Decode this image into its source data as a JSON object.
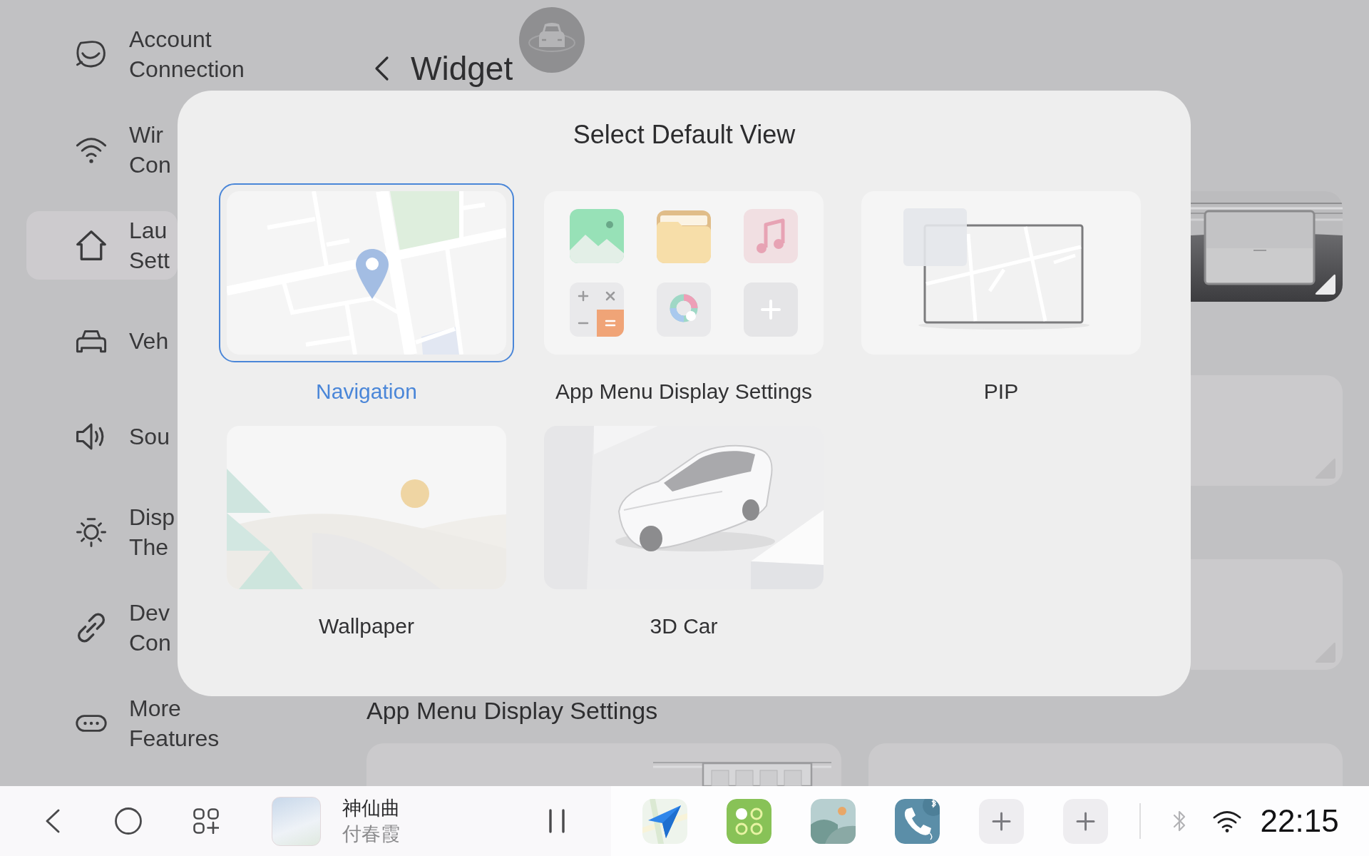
{
  "sidebar": {
    "items": [
      {
        "lines": [
          "Account",
          "Connection"
        ],
        "selected": false
      },
      {
        "lines": [
          "Wir",
          "Con"
        ],
        "selected": false
      },
      {
        "lines": [
          "Lau",
          "Sett"
        ],
        "selected": true
      },
      {
        "lines": [
          "Veh"
        ],
        "selected": false
      },
      {
        "lines": [
          "Sou"
        ],
        "selected": false
      },
      {
        "lines": [
          "Disp",
          "The"
        ],
        "selected": false
      },
      {
        "lines": [
          "Dev",
          "Con"
        ],
        "selected": false
      },
      {
        "lines": [
          "More",
          "Features"
        ],
        "selected": false
      }
    ]
  },
  "header": {
    "title": "Widget"
  },
  "widget_cards": [
    {
      "kind": "dashboard"
    },
    {
      "kind": "plain"
    },
    {
      "kind": "plain"
    }
  ],
  "section": {
    "title": "App Menu Display Settings",
    "cards": [
      {
        "kind": "dashboard"
      },
      {
        "kind": "plain"
      }
    ]
  },
  "dialog": {
    "title": "Select Default View",
    "options": [
      {
        "kind": "navigation",
        "label": "Navigation",
        "selected": true
      },
      {
        "kind": "app_menu",
        "label": "App Menu Display Settings",
        "selected": false
      },
      {
        "kind": "pip",
        "label": "PIP",
        "selected": false
      },
      {
        "kind": "wallpaper",
        "label": "Wallpaper",
        "selected": false
      },
      {
        "kind": "car_3d",
        "label": "3D Car",
        "selected": false
      }
    ]
  },
  "taskbar": {
    "media": {
      "title": "神仙曲",
      "artist": "付春霞",
      "playing": true
    },
    "dock": [
      {
        "kind": "navigation"
      },
      {
        "kind": "apps"
      },
      {
        "kind": "gallery"
      },
      {
        "kind": "phone"
      },
      {
        "kind": "add"
      },
      {
        "kind": "add"
      }
    ],
    "status": {
      "bluetooth_on": false,
      "time": "22:15"
    }
  }
}
